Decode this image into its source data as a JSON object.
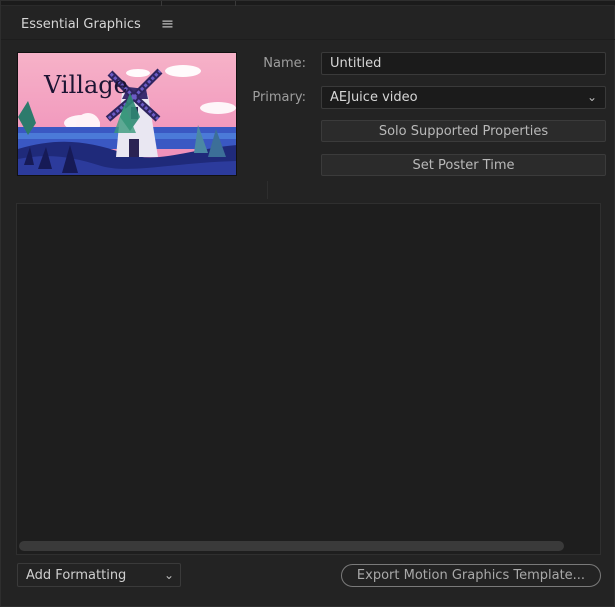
{
  "panel": {
    "title": "Essential Graphics",
    "menu_icon": "hamburger-menu-icon"
  },
  "thumbnail": {
    "text": "Village"
  },
  "fields": {
    "name_label": "Name:",
    "name_value": "Untitled",
    "primary_label": "Primary:",
    "primary_value": "AEJuice video"
  },
  "buttons": {
    "solo": "Solo Supported Properties",
    "poster": "Set Poster Time"
  },
  "bottom": {
    "add_formatting": "Add Formatting",
    "export": "Export Motion Graphics Template..."
  },
  "colors": {
    "panel_bg": "#232323",
    "field_bg": "#1b1b1b",
    "thumb_sky": "#f2a3c2",
    "thumb_water": "#2f3fa7"
  }
}
